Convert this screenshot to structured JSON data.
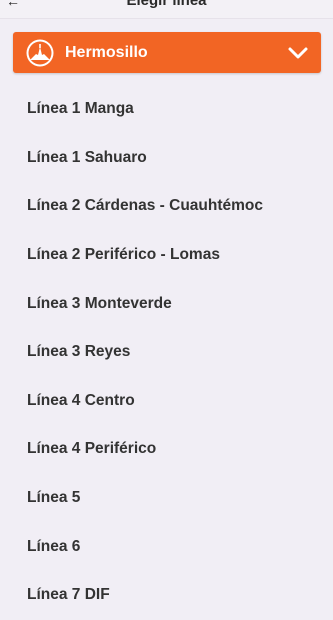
{
  "header": {
    "title": "Elegir línea",
    "back_icon": "arrow-left-icon"
  },
  "city_selector": {
    "value": "Hermosillo",
    "logo_icon": "city-logo-icon",
    "dropdown_icon": "chevron-down-icon",
    "accent_color": "#f26524"
  },
  "lines": [
    "Línea 1 Manga",
    "Línea 1 Sahuaro",
    "Línea 2 Cárdenas - Cuauhtémoc",
    "Línea 2 Periférico - Lomas",
    "Línea 3 Monteverde",
    "Línea 3 Reyes",
    "Línea 4 Centro",
    "Línea 4 Periférico",
    "Línea 5",
    "Línea 6",
    "Línea 7 DIF"
  ]
}
